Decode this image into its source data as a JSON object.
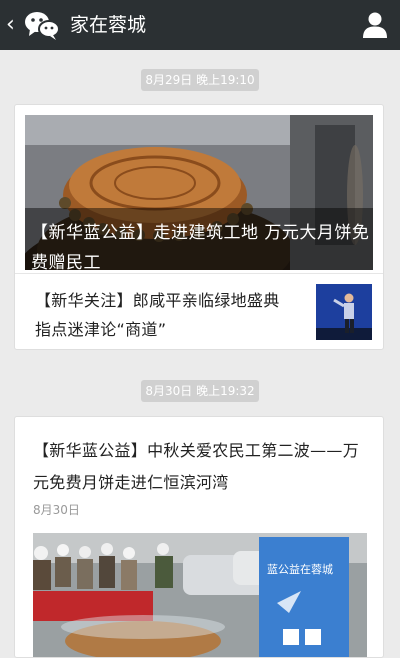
{
  "header": {
    "title": "家在蓉城",
    "back_icon": "chevron-left-icon",
    "logo_icon": "wechat-logo-icon",
    "profile_icon": "person-icon"
  },
  "messages": [
    {
      "time": "8月29日 晚上19:10",
      "main_article": {
        "title": "【新华蓝公益】走进建筑工地 万元大月饼免费赠民工"
      },
      "sub_articles": [
        {
          "title": "【新华关注】郎咸平亲临绿地盛典 指点迷津论“商道”"
        }
      ]
    },
    {
      "time": "8月30日 晚上19:32",
      "article": {
        "title": "【新华蓝公益】中秋关爱农民工第二波——万元免费月饼走进仁恒滨河湾",
        "date": "8月30日",
        "image_banner_text": "蓝公益在蓉城"
      }
    }
  ]
}
